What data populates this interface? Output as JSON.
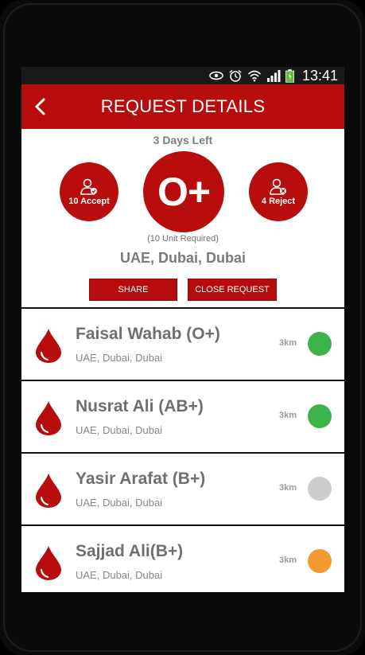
{
  "status_bar": {
    "time": "13:41",
    "icons": [
      "eye-icon",
      "alarm-icon",
      "wifi-icon",
      "signal-icon",
      "battery-icon"
    ]
  },
  "header": {
    "title": "REQUEST DETAILS",
    "back_icon": "back-arrow-icon"
  },
  "summary": {
    "days_left": "3 Days Left",
    "blood_group": "O+",
    "accept_label": "10 Accept",
    "reject_label": "4 Reject",
    "units_required": "(10 Unit Required)",
    "location": "UAE, Dubai, Dubai"
  },
  "actions": {
    "share_label": "SHARE",
    "close_label": "CLOSE REQUEST"
  },
  "donors": [
    {
      "name": "Faisal Wahab (O+)",
      "location": "UAE, Dubai, Dubai",
      "distance": "3km",
      "status_color": "#3cb44a"
    },
    {
      "name": "Nusrat Ali (AB+)",
      "location": "UAE, Dubai, Dubai",
      "distance": "3km",
      "status_color": "#3cb44a"
    },
    {
      "name": "Yasir Arafat (B+)",
      "location": "UAE, Dubai, Dubai",
      "distance": "3km",
      "status_color": "#cccccc"
    },
    {
      "name": "Sajjad Ali(B+)",
      "location": "UAE, Dubai, Dubai",
      "distance": "3km",
      "status_color": "#f29a2e"
    }
  ],
  "colors": {
    "accent": "#b80d0d",
    "status_bar": "#1a1a1a"
  }
}
